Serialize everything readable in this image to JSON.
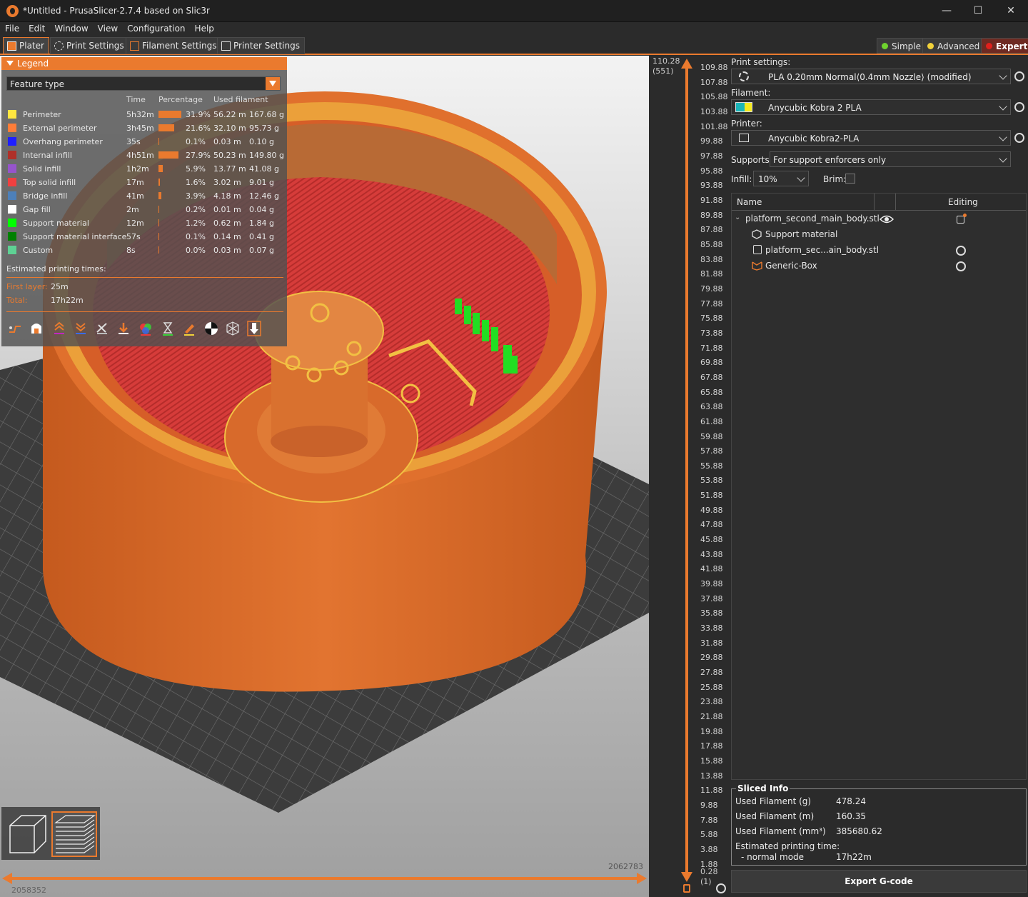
{
  "window": {
    "title": "*Untitled - PrusaSlicer-2.7.4 based on Slic3r",
    "minimize": "—",
    "maximize": "☐",
    "close": "✕"
  },
  "menu": [
    "File",
    "Edit",
    "Window",
    "View",
    "Configuration",
    "Help"
  ],
  "tabs": [
    "Plater",
    "Print Settings",
    "Filament Settings",
    "Printer Settings"
  ],
  "modes": [
    {
      "label": "Simple",
      "color": "#6fd32e"
    },
    {
      "label": "Advanced",
      "color": "#f2d23a"
    },
    {
      "label": "Expert",
      "color": "#e0201c"
    }
  ],
  "legend": {
    "title": "Legend",
    "view_type": "Feature type",
    "columns": {
      "time": "Time",
      "percentage": "Percentage",
      "used_filament": "Used filament"
    },
    "rows": [
      {
        "name": "Perimeter",
        "color": "#ffe640",
        "time": "5h32m",
        "pct": "31.9%",
        "pct_value": 31.9,
        "len": "56.22 m",
        "weight": "167.68 g"
      },
      {
        "name": "External perimeter",
        "color": "#ff7d38",
        "time": "3h45m",
        "pct": "21.6%",
        "pct_value": 21.6,
        "len": "32.10 m",
        "weight": "95.73 g"
      },
      {
        "name": "Overhang perimeter",
        "color": "#1f1fff",
        "time": "35s",
        "pct": "0.1%",
        "pct_value": 0.1,
        "len": "0.03 m",
        "weight": "0.10 g"
      },
      {
        "name": "Internal infill",
        "color": "#b03029",
        "time": "4h51m",
        "pct": "27.9%",
        "pct_value": 27.9,
        "len": "50.23 m",
        "weight": "149.80 g"
      },
      {
        "name": "Solid infill",
        "color": "#9654cc",
        "time": "1h2m",
        "pct": "5.9%",
        "pct_value": 5.9,
        "len": "13.77 m",
        "weight": "41.08 g"
      },
      {
        "name": "Top solid infill",
        "color": "#f04040",
        "time": "17m",
        "pct": "1.6%",
        "pct_value": 1.6,
        "len": "3.02 m",
        "weight": "9.01 g"
      },
      {
        "name": "Bridge infill",
        "color": "#4d80ba",
        "time": "41m",
        "pct": "3.9%",
        "pct_value": 3.9,
        "len": "4.18 m",
        "weight": "12.46 g"
      },
      {
        "name": "Gap fill",
        "color": "#ffffff",
        "time": "2m",
        "pct": "0.2%",
        "pct_value": 0.2,
        "len": "0.01 m",
        "weight": "0.04 g"
      },
      {
        "name": "Support material",
        "color": "#00ff00",
        "time": "12m",
        "pct": "1.2%",
        "pct_value": 1.2,
        "len": "0.62 m",
        "weight": "1.84 g"
      },
      {
        "name": "Support material interface",
        "color": "#008000",
        "time": "57s",
        "pct": "0.1%",
        "pct_value": 0.1,
        "len": "0.14 m",
        "weight": "0.41 g"
      },
      {
        "name": "Custom",
        "color": "#5ed194",
        "time": "8s",
        "pct": "0.0%",
        "pct_value": 0.0,
        "len": "0.03 m",
        "weight": "0.07 g"
      }
    ],
    "estimated_label": "Estimated printing times:",
    "first_layer_label": "First layer:",
    "first_layer_value": "25m",
    "total_label": "Total:",
    "total_value": "17h22m"
  },
  "vertical_slider": {
    "top_value": "110.28",
    "top_layer": "(551)",
    "bottom_value": "0.28",
    "bottom_layer": "(1)",
    "ticks": [
      "109.88",
      "107.88",
      "105.88",
      "103.88",
      "101.88",
      "99.88",
      "97.88",
      "95.88",
      "93.88",
      "91.88",
      "89.88",
      "87.88",
      "85.88",
      "83.88",
      "81.88",
      "79.88",
      "77.88",
      "75.88",
      "73.88",
      "71.88",
      "69.88",
      "67.88",
      "65.88",
      "63.88",
      "61.88",
      "59.88",
      "57.88",
      "55.88",
      "53.88",
      "51.88",
      "49.88",
      "47.88",
      "45.88",
      "43.88",
      "41.88",
      "39.88",
      "37.88",
      "35.88",
      "33.88",
      "31.88",
      "29.88",
      "27.88",
      "25.88",
      "23.88",
      "21.88",
      "19.88",
      "17.88",
      "15.88",
      "13.88",
      "11.88",
      "9.88",
      "7.88",
      "5.88",
      "3.88",
      "1.88"
    ]
  },
  "horizontal_slider": {
    "left_value": "2058352",
    "right_value": "2062783"
  },
  "sidebar": {
    "print_settings_label": "Print settings:",
    "print_profile": "PLA 0.20mm Normal⟨0.4mm Nozzle⟩ (modified)",
    "filament_label": "Filament:",
    "filament_profile": "Anycubic Kobra 2 PLA",
    "filament_colors": [
      "#1bb5b8",
      "#f5e91c"
    ],
    "printer_label": "Printer:",
    "printer_profile": "Anycubic Kobra2-PLA",
    "supports_label": "Supports:",
    "supports_value": "For support enforcers only",
    "infill_label": "Infill:",
    "infill_value": "10%",
    "brim_label": "Brim:",
    "brim_checked": false
  },
  "object_list": {
    "col_name": "Name",
    "col_editing": "Editing",
    "items": [
      {
        "name": "platform_second_main_body.stl",
        "icon": "eye-icon"
      },
      {
        "name": "Support material",
        "icon": "support-material-icon"
      },
      {
        "name": "platform_sec...ain_body.stl",
        "icon": "part-icon"
      },
      {
        "name": "Generic-Box",
        "icon": "box-modifier-icon"
      }
    ]
  },
  "sliced_info": {
    "title": "Sliced Info",
    "rows": [
      {
        "label": "Used Filament (g)",
        "value": "478.24"
      },
      {
        "label": "Used Filament (m)",
        "value": "160.35"
      },
      {
        "label": "Used Filament (mm³)",
        "value": "385680.62"
      }
    ],
    "est_label": "Estimated printing time:",
    "mode_label": "- normal mode",
    "mode_value": "17h22m"
  },
  "export_button": "Export G-code",
  "accent": "#ea7a2e"
}
